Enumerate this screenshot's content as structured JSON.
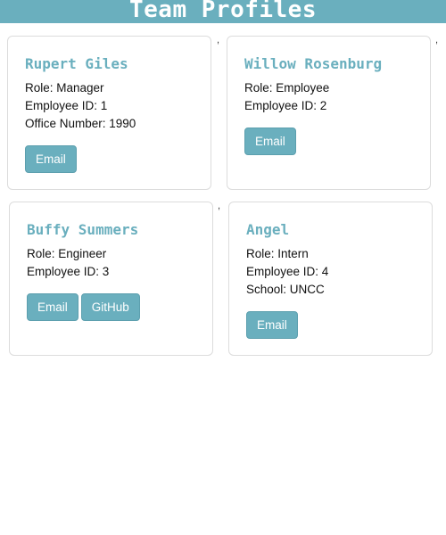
{
  "header": {
    "title": "Team Profiles"
  },
  "colors": {
    "accent": "#6aafbe",
    "card_border": "#dcdcdc",
    "text": "#111111"
  },
  "cards": [
    {
      "name": "Rupert Giles",
      "role": "Role: Manager",
      "id": "Employee ID: 1",
      "extra": "Office Number: 1990",
      "email_label": "Email"
    },
    {
      "name": "Willow Rosenburg",
      "role": "Role: Employee",
      "id": "Employee ID: 2",
      "email_label": "Email"
    },
    {
      "name": "Buffy Summers",
      "role": "Role: Engineer",
      "id": "Employee ID: 3",
      "email_label": "Email",
      "github_label": "GitHub"
    },
    {
      "name": "Angel",
      "role": "Role: Intern",
      "id": "Employee ID: 4",
      "extra": "School: UNCC",
      "email_label": "Email"
    }
  ],
  "separator": ","
}
